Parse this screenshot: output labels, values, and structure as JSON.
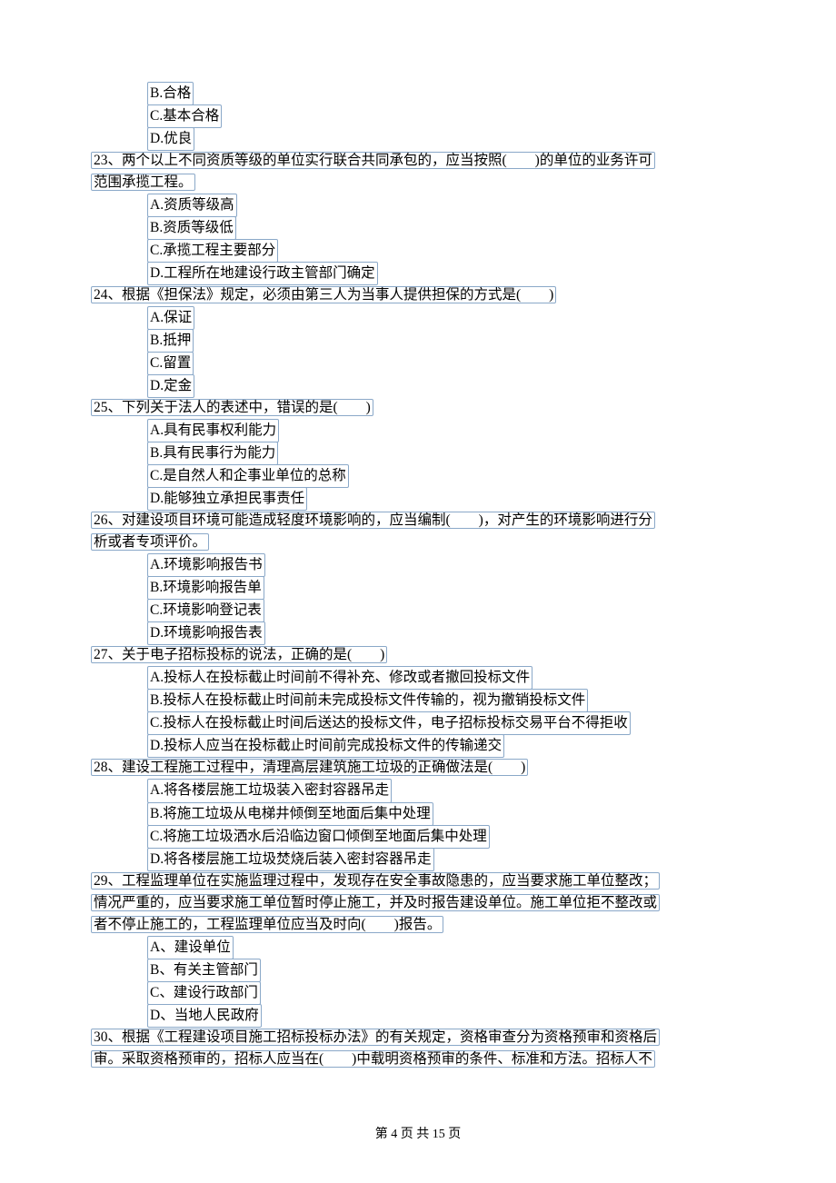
{
  "orphan_options": {
    "items": [
      "B.合格",
      "C.基本合格",
      "D.优良"
    ]
  },
  "q23": {
    "stem1": "23、两个以上不同资质等级的单位实行联合共同承包的，应当按照(　　)的单位的业务许可",
    "stem2": "范围承揽工程。",
    "opts": [
      "A.资质等级高",
      "B.资质等级低",
      "C.承揽工程主要部分",
      "D.工程所在地建设行政主管部门确定"
    ]
  },
  "q24": {
    "stem1": "24、根据《担保法》规定，必须由第三人为当事人提供担保的方式是(　　)",
    "opts": [
      "A.保证",
      "B.抵押",
      "C.留置",
      "D.定金"
    ]
  },
  "q25": {
    "stem1": "25、下列关于法人的表述中，错误的是(　　)",
    "opts": [
      "A.具有民事权利能力",
      "B.具有民事行为能力",
      "C.是自然人和企事业单位的总称",
      "D.能够独立承担民事责任"
    ]
  },
  "q26": {
    "stem1": "26、对建设项目环境可能造成轻度环境影响的，应当编制(　　)，对产生的环境影响进行分",
    "stem2": "析或者专项评价。",
    "opts": [
      "A.环境影响报告书",
      "B.环境影响报告单",
      "C.环境影响登记表",
      "D.环境影响报告表"
    ]
  },
  "q27": {
    "stem1": "27、关于电子招标投标的说法，正确的是(　　)",
    "opts": [
      "A.投标人在投标截止时间前不得补充、修改或者撤回投标文件",
      "B.投标人在投标截止时间前未完成投标文件传输的，视为撤销投标文件",
      "C.投标人在投标截止时间后送达的投标文件，电子招标投标交易平台不得拒收",
      "D.投标人应当在投标截止时间前完成投标文件的传输递交"
    ]
  },
  "q28": {
    "stem1": "28、建设工程施工过程中，清理高层建筑施工垃圾的正确做法是(　　)",
    "opts": [
      "A.将各楼层施工垃圾装入密封容器吊走",
      "B.将施工垃圾从电梯井倾倒至地面后集中处理",
      "C.将施工垃圾洒水后沿临边窗口倾倒至地面后集中处理",
      "D.将各楼层施工垃圾焚烧后装入密封容器吊走"
    ]
  },
  "q29": {
    "stem1": "29、工程监理单位在实施监理过程中，发现存在安全事故隐患的，应当要求施工单位整改；",
    "stem2": "情况严重的，应当要求施工单位暂时停止施工，并及时报告建设单位。施工单位拒不整改或",
    "stem3": "者不停止施工的，工程监理单位应当及时向(　　)报告。",
    "opts": [
      "A、建设单位",
      "B、有关主管部门",
      "C、建设行政部门",
      "D、当地人民政府"
    ]
  },
  "q30": {
    "stem1": "30、根据《工程建设项目施工招标投标办法》的有关规定，资格审查分为资格预审和资格后",
    "stem2": "审。采取资格预审的，招标人应当在(　　)中载明资格预审的条件、标准和方法。招标人不"
  },
  "footer": "第 4 页 共 15 页"
}
